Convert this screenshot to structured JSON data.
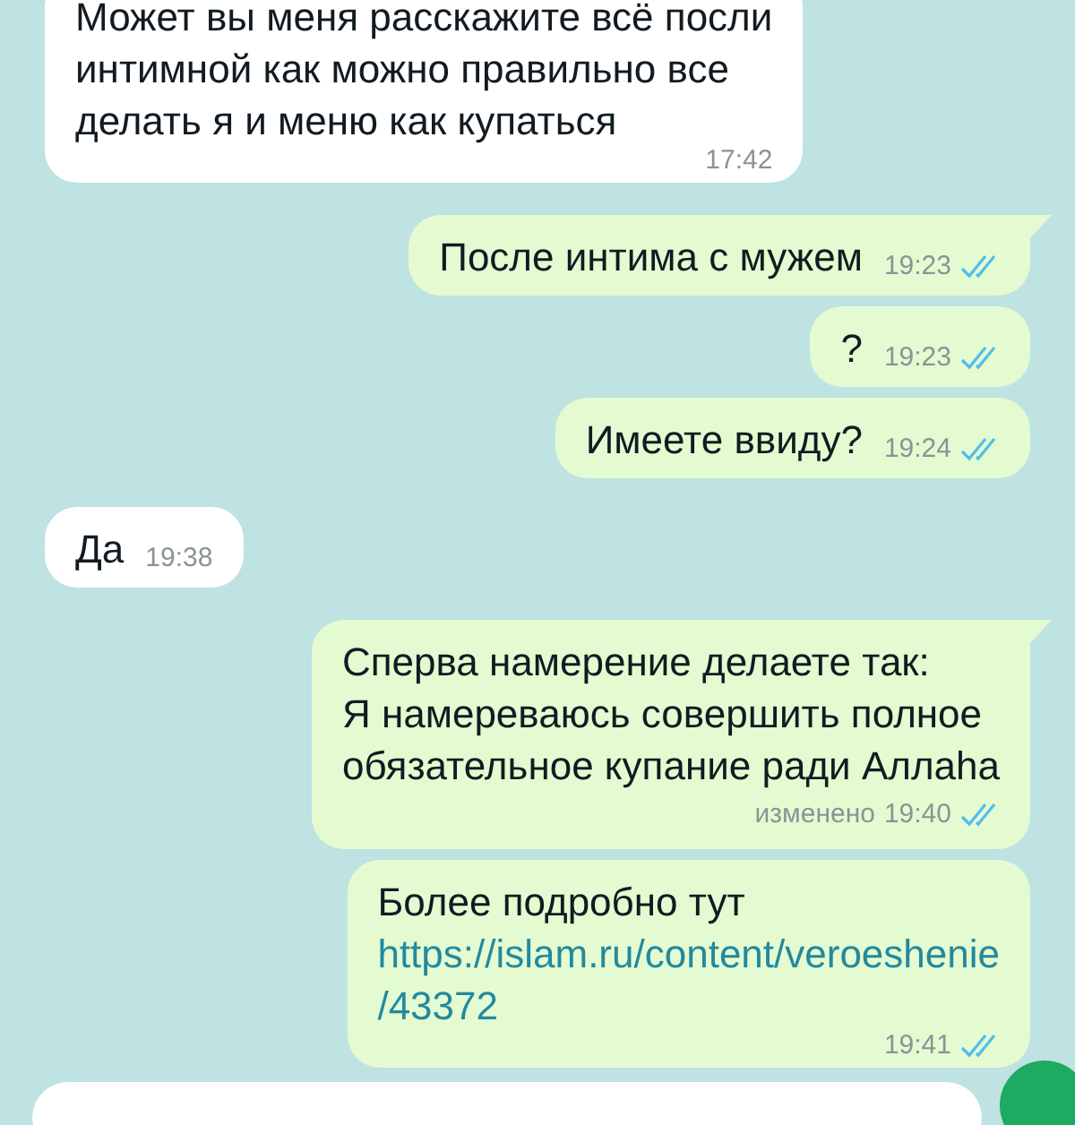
{
  "messages": [
    {
      "kind": "incoming",
      "text": "Может вы меня расскажите всё посли\nинтимной как можно правильно все\nделать я и меню как купаться",
      "time": "17:42",
      "tail": false
    },
    {
      "kind": "outgoing",
      "text": "После интима с мужем",
      "time": "19:23",
      "read": true,
      "tail": true
    },
    {
      "kind": "outgoing",
      "text": "?",
      "time": "19:23",
      "read": true,
      "tail": false
    },
    {
      "kind": "outgoing",
      "text": "Имеете ввиду?",
      "time": "19:24",
      "read": true,
      "tail": false
    },
    {
      "kind": "incoming",
      "text": "Да",
      "time": "19:38",
      "tail": false
    },
    {
      "kind": "outgoing",
      "text": "Сперва намерение делаете так:\nЯ намереваюсь совершить полное\nобязательное купание ради Аллаhа",
      "edited_label": "изменено",
      "time": "19:40",
      "read": true,
      "tail": true
    },
    {
      "kind": "outgoing",
      "text": "Более подробно тут",
      "link": "https://islam.ru/content/veroeshenie/43372",
      "time": "19:41",
      "read": true,
      "tail": false
    }
  ]
}
